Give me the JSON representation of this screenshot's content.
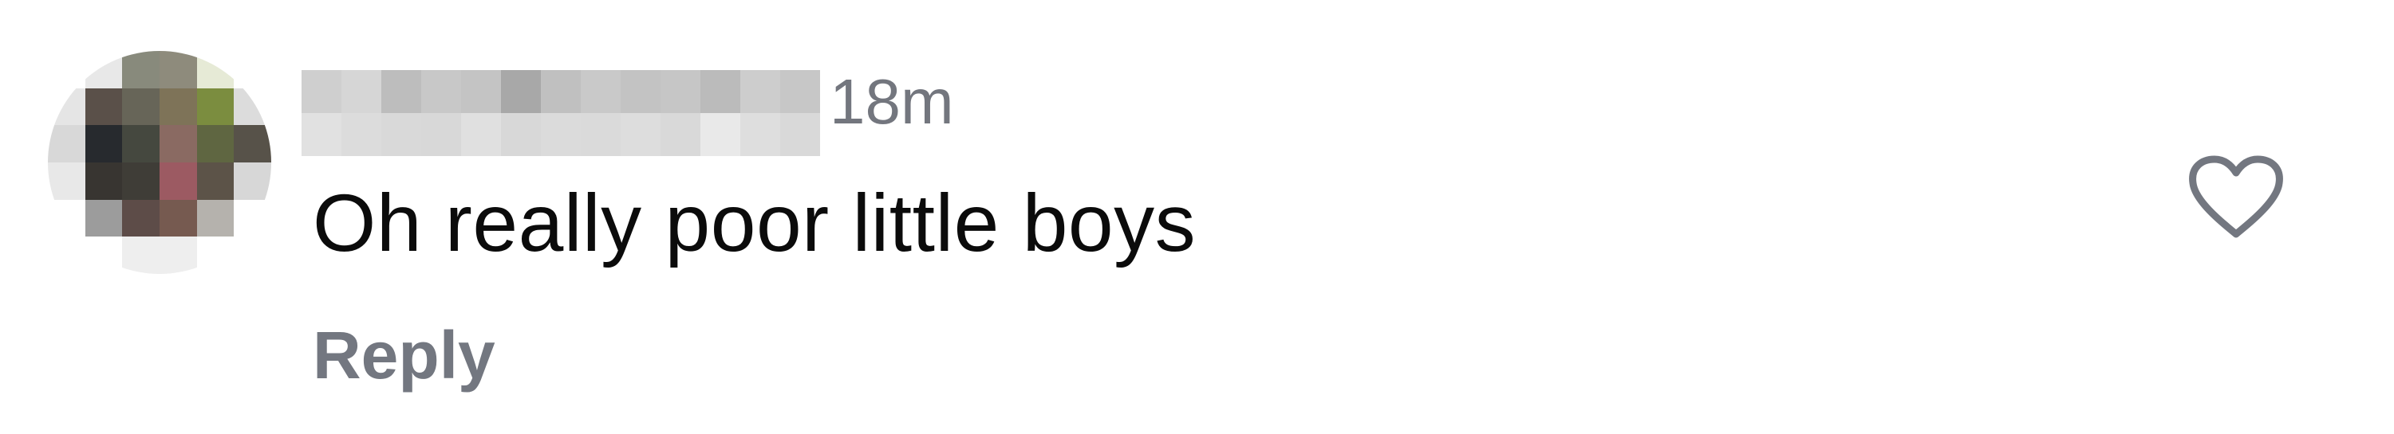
{
  "comment": {
    "timestamp": "18m",
    "text": "Oh really poor little boys",
    "reply_label": "Reply"
  },
  "icons": {
    "avatar": "blurred-avatar",
    "like": "heart-outline-icon"
  },
  "colors": {
    "text_primary": "#0b0b0b",
    "text_secondary": "#737780",
    "icon": "#737780"
  }
}
